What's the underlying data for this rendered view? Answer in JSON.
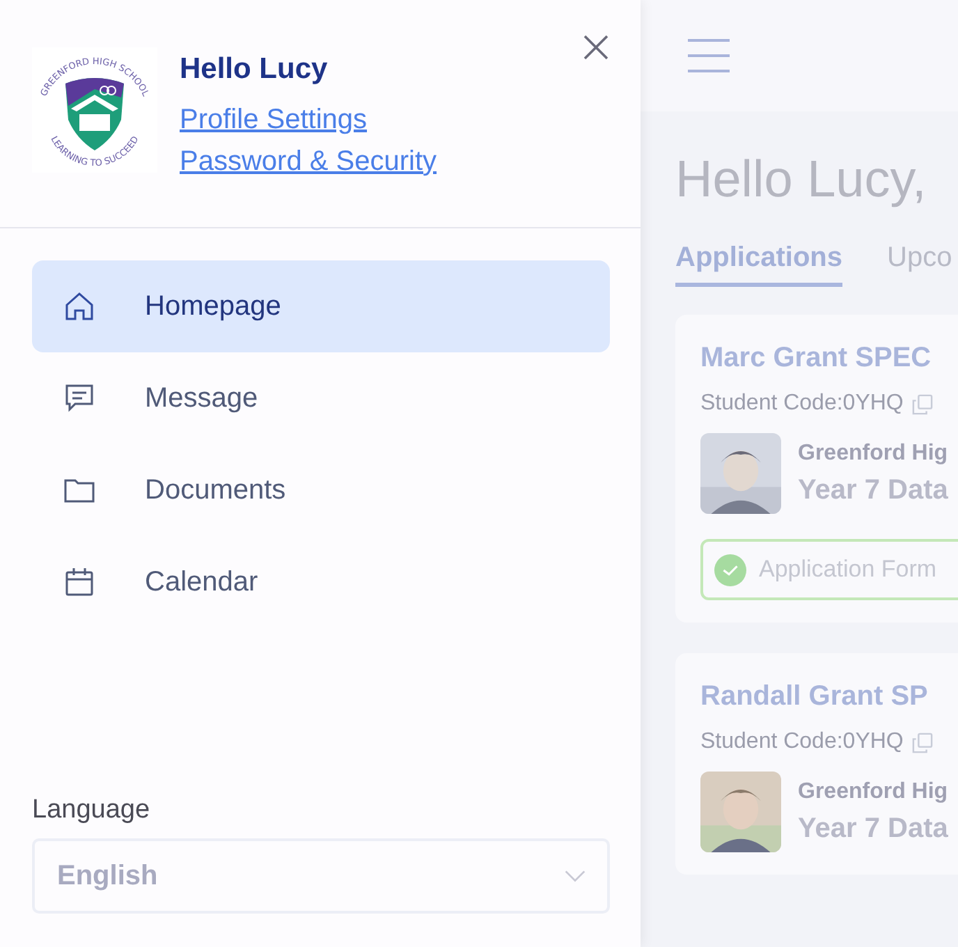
{
  "drawer": {
    "logo": {
      "top_text": "GREENFORD HIGH SCHOOL",
      "bottom_text": "LEARNING TO SUCCEED"
    },
    "greeting": "Hello Lucy",
    "links": [
      "Profile Settings",
      "Password & Security"
    ],
    "nav": [
      {
        "label": "Homepage",
        "kind": "home",
        "selected": true
      },
      {
        "label": "Message",
        "kind": "message",
        "selected": false
      },
      {
        "label": "Documents",
        "kind": "folder",
        "selected": false
      },
      {
        "label": "Calendar",
        "kind": "calendar",
        "selected": false
      }
    ],
    "language": {
      "label": "Language",
      "value": "English"
    }
  },
  "main": {
    "heading": "Hello Lucy,",
    "tabs": [
      {
        "label": "Applications",
        "selected": true
      },
      {
        "label": "Upco",
        "selected": false
      }
    ],
    "cards": [
      {
        "name": "Marc Grant SPEC",
        "code": "Student Code:0YHQ",
        "school": "Greenford Hig",
        "year": "Year 7 Data",
        "status": "Application Form",
        "done": true
      },
      {
        "name": "Randall Grant SP",
        "code": "Student Code:0YHQ",
        "school": "Greenford Hig",
        "year": "Year 7 Data"
      }
    ]
  }
}
